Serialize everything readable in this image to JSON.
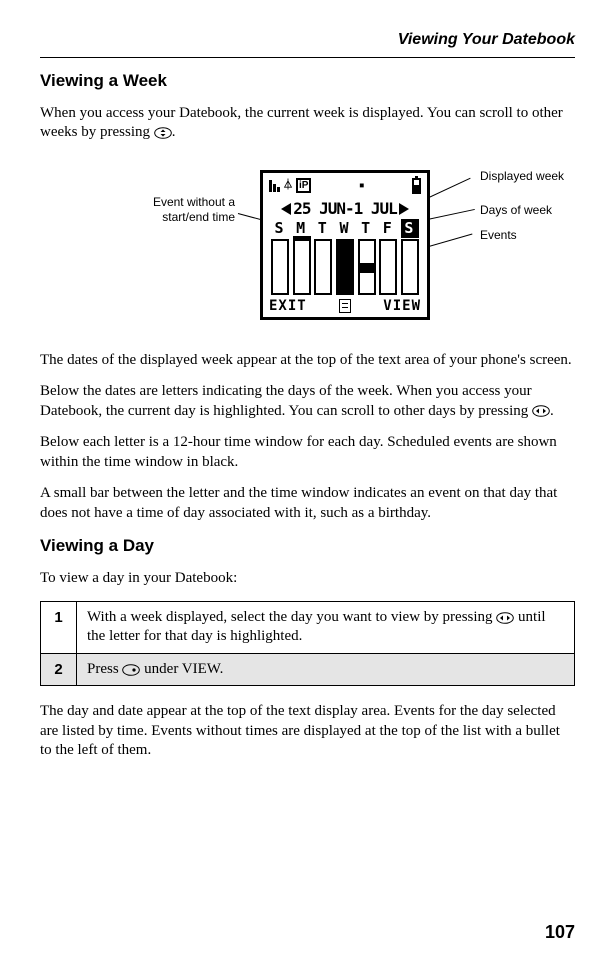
{
  "header": {
    "running_title": "Viewing Your Datebook"
  },
  "section1": {
    "heading": "Viewing a Week",
    "p1a": "When you access your Datebook, the current week is displayed. You can scroll to other weeks by pressing ",
    "p1b": ".",
    "p2": "The dates of the displayed week appear at the top of the text area of your phone's screen.",
    "p3a": "Below the dates are letters indicating the days of the week. When you access your Datebook, the current day is highlighted. You can scroll to other days by pressing ",
    "p3b": ".",
    "p4": "Below each letter is a 12-hour time window for each day. Scheduled events are shown within the time window in black.",
    "p5": "A small bar between the letter and the time window indicates an event on that day that does not have a time of day associated with it, such as a birthday."
  },
  "section2": {
    "heading": "Viewing a Day",
    "intro": "To view a day in your Datebook:",
    "steps": [
      {
        "n": "1",
        "a": "With a week displayed, select the day you want to view by pressing ",
        "b": " until the letter for that day is highlighted."
      },
      {
        "n": "2",
        "a": "Press ",
        "b": " under VIEW."
      }
    ],
    "after": "The day and date appear at the top of the text display area. Events for the day selected are listed by time. Events without times are displayed at the top of the list with a bullet to the left of them."
  },
  "figure": {
    "callouts": {
      "left": "Event without a start/end time",
      "r1": "Displayed week",
      "r2": "Days of week",
      "r3": "Events"
    },
    "screen": {
      "date": "25 JUN-1 JUL",
      "days": [
        "S",
        "M",
        "T",
        "W",
        "T",
        "F",
        "S"
      ],
      "soft_left": "EXIT",
      "soft_right": "VIEW",
      "ip": "iP"
    }
  },
  "page_number": "107"
}
